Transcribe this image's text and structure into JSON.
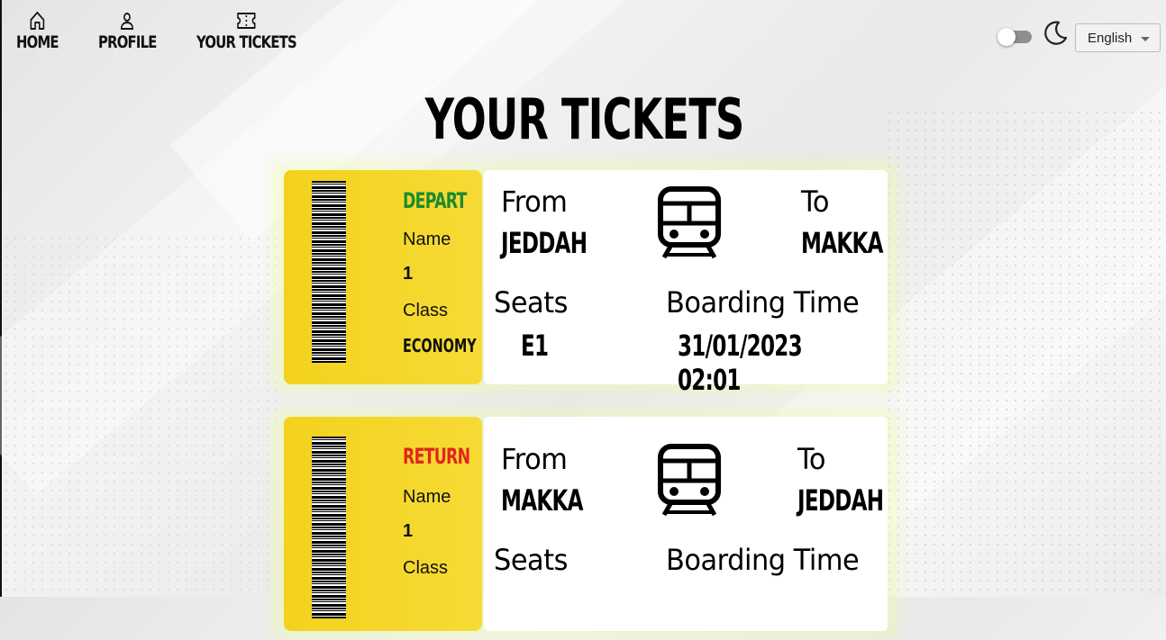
{
  "nav": {
    "items": [
      {
        "label": "HOME",
        "icon": "home-icon"
      },
      {
        "label": "PROFILE",
        "icon": "user-icon"
      },
      {
        "label": "YOUR TICKETS",
        "icon": "ticket-icon"
      }
    ]
  },
  "controls": {
    "theme_toggle": "off",
    "moon_icon": "moon-icon",
    "language": "English"
  },
  "page_title": "YOUR TICKETS",
  "labels": {
    "name": "Name",
    "class": "Class",
    "from": "From",
    "to": "To",
    "seats": "Seats",
    "boarding_time": "Boarding Time"
  },
  "tickets": [
    {
      "direction": "DEPART",
      "direction_color": "#1d8a30",
      "name": "1",
      "class": "ECONOMY",
      "from": "JEDDAH",
      "to": "MAKKA",
      "seat": "E1",
      "boarding_time": "31/01/2023 02:01"
    },
    {
      "direction": "RETURN",
      "direction_color": "#e0261b",
      "name": "1",
      "class": "",
      "from": "MAKKA",
      "to": "JEDDAH",
      "seat": "",
      "boarding_time": ""
    }
  ],
  "colors": {
    "stub": "#f3d21e",
    "depart": "#1d8a30",
    "return": "#e0261b"
  }
}
